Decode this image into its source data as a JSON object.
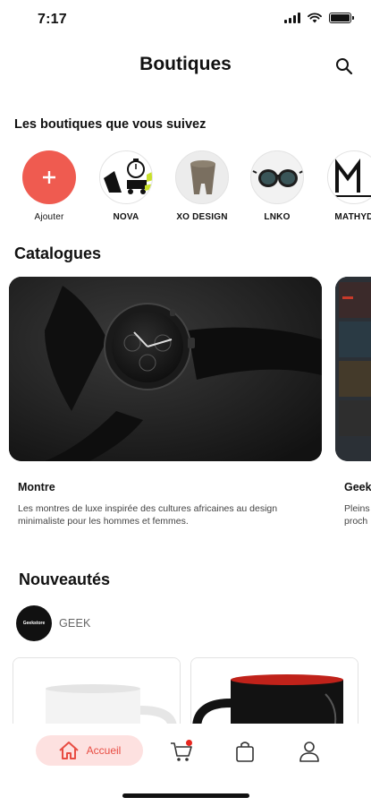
{
  "status": {
    "time": "7:17"
  },
  "header": {
    "title": "Boutiques"
  },
  "followed": {
    "title": "Les boutiques que vous suivez",
    "items": [
      {
        "label": "Ajouter"
      },
      {
        "label": "NOVA"
      },
      {
        "label": "XO DESIGN"
      },
      {
        "label": "LNKO"
      },
      {
        "label": "MATHYD"
      }
    ]
  },
  "catalogues": {
    "title": "Catalogues",
    "cards": [
      {
        "name": "Montre",
        "description": "Les montres de luxe inspirée des cultures africaines au design minimaliste pour les hommes et femmes."
      },
      {
        "name": "Geek",
        "description": "Pleins proch"
      }
    ]
  },
  "nouveautes": {
    "title": "Nouveautés",
    "vendor": {
      "name": "GEEK",
      "avatar_text": "Geekstore"
    }
  },
  "nav": {
    "home_label": "Accueil"
  },
  "colors": {
    "accent": "#ef5b50",
    "accent_soft": "#fde1e0"
  }
}
